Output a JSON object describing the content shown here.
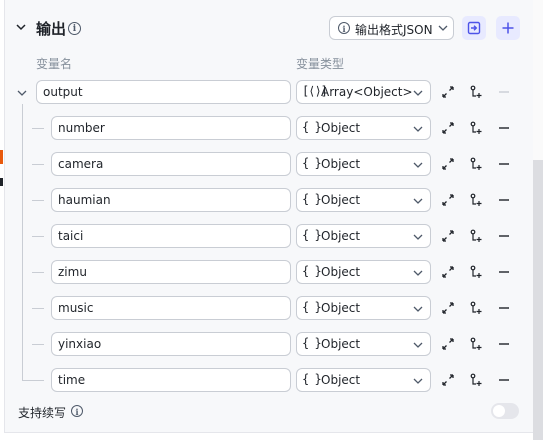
{
  "section": {
    "title": "输出",
    "output_format_label": "输出格式JSON"
  },
  "columns": {
    "name": "变量名",
    "type": "变量类型"
  },
  "root": {
    "name": "output",
    "type_icon": "[⟨⟩]",
    "type": "Array<Object>"
  },
  "children": [
    {
      "name": "number",
      "type_icon": "{ }",
      "type": "Object"
    },
    {
      "name": "camera",
      "type_icon": "{ }",
      "type": "Object"
    },
    {
      "name": "haumian",
      "type_icon": "{ }",
      "type": "Object"
    },
    {
      "name": "taici",
      "type_icon": "{ }",
      "type": "Object"
    },
    {
      "name": "zimu",
      "type_icon": "{ }",
      "type": "Object"
    },
    {
      "name": "music",
      "type_icon": "{ }",
      "type": "Object"
    },
    {
      "name": "yinxiao",
      "type_icon": "{ }",
      "type": "Object"
    },
    {
      "name": "time",
      "type_icon": "{ }",
      "type": "Object"
    }
  ],
  "footer": {
    "stream_label": "支持续写",
    "stream_enabled": false
  },
  "colors": {
    "accent": "#4d53e8",
    "accent_bg": "#e8eaff",
    "border": "#c9cdd4",
    "muted_text": "#86909c",
    "icon": "#1f2329"
  },
  "icons": {
    "section_toggle": "chevron-down-icon",
    "info": "info-icon",
    "import": "import-icon",
    "add": "plus-icon",
    "expand": "expand-icon",
    "add_child": "add-child-icon",
    "remove": "minus-icon"
  }
}
